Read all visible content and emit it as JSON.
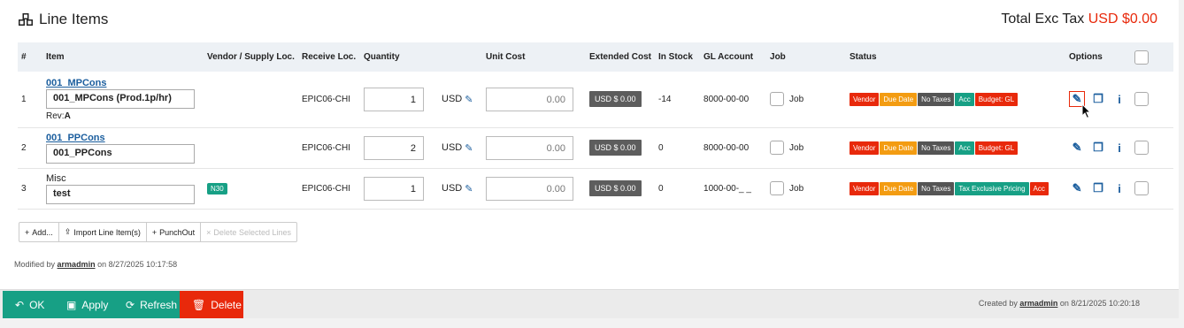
{
  "header": {
    "title": "Line Items",
    "total_label": "Total Exc Tax",
    "total_value": "USD $0.00"
  },
  "columns": {
    "num": "#",
    "item": "Item",
    "vendor": "Vendor / Supply Loc.",
    "receive": "Receive Loc.",
    "quantity": "Quantity",
    "unit_cost": "Unit Cost",
    "extended": "Extended Cost",
    "stock": "In Stock",
    "gl": "GL Account",
    "job": "Job",
    "status": "Status",
    "options": "Options"
  },
  "rows": [
    {
      "num": "1",
      "item_link": "001_MPCons",
      "item_name": "001_MPCons (Prod.1p/hr)",
      "rev_label": "Rev:",
      "rev_value": "A",
      "vendor_badge": "",
      "receive": "EPIC06-CHI",
      "quantity": "1",
      "currency": "USD",
      "unit_cost": "0.00",
      "extended": "USD $ 0.00",
      "stock": "-14",
      "gl": "8000-00-00",
      "job": "Job",
      "badges": [
        "Vendor",
        "Due Date",
        "No Taxes",
        "Acc",
        "Budget: GL"
      ]
    },
    {
      "num": "2",
      "item_link": "001_PPCons",
      "item_name": "001_PPCons",
      "vendor_badge": "",
      "receive": "EPIC06-CHI",
      "quantity": "2",
      "currency": "USD",
      "unit_cost": "0.00",
      "extended": "USD $ 0.00",
      "stock": "0",
      "gl": "8000-00-00",
      "job": "Job",
      "badges": [
        "Vendor",
        "Due Date",
        "No Taxes",
        "Acc",
        "Budget: GL"
      ]
    },
    {
      "num": "3",
      "item_label": "Misc",
      "item_name": "test",
      "vendor_badge": "N30",
      "receive": "EPIC06-CHI",
      "quantity": "1",
      "currency": "USD",
      "unit_cost": "0.00",
      "extended": "USD $ 0.00",
      "stock": "0",
      "gl": "1000-00-_ _",
      "job": "Job",
      "badges": [
        "Vendor",
        "Due Date",
        "No Taxes",
        "Tax Exclusive Pricing",
        "Acc"
      ]
    }
  ],
  "toolbar": {
    "add": "Add...",
    "import": "Import Line Item(s)",
    "punchout": "PunchOut",
    "delete_selected": "Delete Selected Lines"
  },
  "modified": {
    "prefix": "Modified by",
    "user": "armadmin",
    "suffix": "on 8/27/2025 10:17:58"
  },
  "footer": {
    "ok": "OK",
    "apply": "Apply",
    "refresh": "Refresh",
    "delete": "Delete",
    "created_prefix": "Created by",
    "created_user": "armadmin",
    "created_suffix": "on 8/21/2025 10:20:18"
  },
  "colors": {
    "accent_teal": "#17a085",
    "danger_red": "#e8290b",
    "warning_orange": "#f39c12",
    "link_blue": "#1b5e9e"
  },
  "icons": {
    "title": "cubes-icon",
    "edit": "edit-icon",
    "copy": "copy-icon",
    "info": "info-icon"
  }
}
